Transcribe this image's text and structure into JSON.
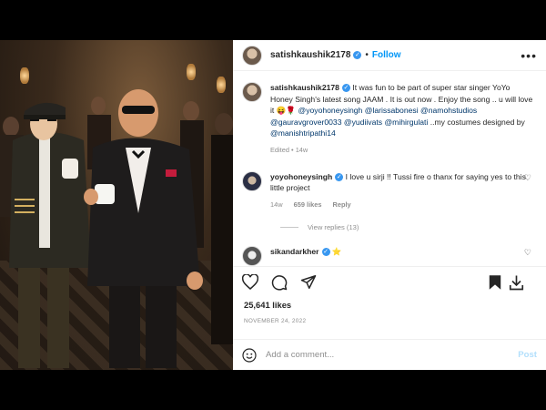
{
  "post": {
    "username": "satishkaushik2178",
    "separator": "•",
    "follow_label": "Follow",
    "more_label": "•••"
  },
  "caption": {
    "username": "satishkaushik2178",
    "text_1": "It was fun to be part of super star singer YoYo Honey Singh's latest song JAAM . It is out now . Enjoy the song .. u will love it 😝🌹 ",
    "mentions": [
      "@yoyohoneysingh",
      "@larissabonesi",
      "@namohstudios",
      "@gauravgrover0033",
      "@yudiivats",
      "@mihirgulati"
    ],
    "text_2": "..my costumes designed by ",
    "mention_last": "@manishtripathi14",
    "edited": "Edited",
    "time": "14w"
  },
  "comment1": {
    "username": "yoyohoneysingh",
    "text": "I love u sirji !! Tussi fire o thanx for saying yes to this little project",
    "time": "14w",
    "likes": "659 likes",
    "reply": "Reply",
    "view_replies": "View replies (13)"
  },
  "comment2": {
    "username": "sikandarkher",
    "text": "⭐"
  },
  "stats": {
    "likes": "25,641 likes",
    "date": "NOVEMBER 24, 2022"
  },
  "add_comment": {
    "placeholder": "Add a comment...",
    "post_label": "Post"
  },
  "icons": [
    "heart-icon",
    "comment-icon",
    "share-icon",
    "bookmark-icon",
    "emoji-icon",
    "more-icon",
    "verified-icon"
  ],
  "colors": {
    "link": "#0095f6",
    "mention": "#00376b",
    "muted": "#8e8e8e",
    "verified": "#3897f0"
  }
}
